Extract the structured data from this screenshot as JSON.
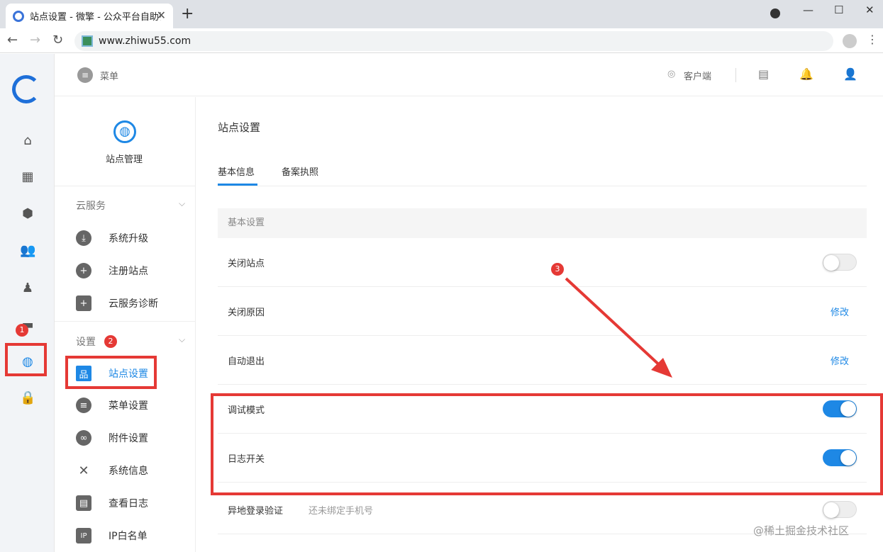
{
  "browser": {
    "tab_title": "站点设置 - 微擎 - 公众平台自助引",
    "url": "www.zhiwu55.com"
  },
  "topbar": {
    "menu_label": "菜单",
    "client_label": "客户端"
  },
  "subnav": {
    "title": "站点管理",
    "sections": {
      "cloud": {
        "title": "云服务",
        "items": [
          "系统升级",
          "注册站点",
          "云服务诊断"
        ]
      },
      "settings": {
        "title": "设置",
        "items": [
          "站点设置",
          "菜单设置",
          "附件设置",
          "系统信息",
          "查看日志",
          "IP白名单"
        ]
      }
    }
  },
  "main": {
    "title": "站点设置",
    "tabs": [
      "基本信息",
      "备案执照"
    ],
    "section_header": "基本设置",
    "rows": [
      {
        "label": "关闭站点",
        "toggle": false
      },
      {
        "label": "关闭原因",
        "action": "修改"
      },
      {
        "label": "自动退出",
        "action": "修改"
      },
      {
        "label": "调试模式",
        "toggle": true
      },
      {
        "label": "日志开关",
        "toggle": true
      },
      {
        "label": "异地登录验证",
        "hint": "还未绑定手机号",
        "toggle": false
      }
    ]
  },
  "annotations": [
    "1",
    "2",
    "3"
  ],
  "watermark": "@稀土掘金技术社区",
  "colors": {
    "accent": "#1e88e5",
    "highlight": "#e53935"
  }
}
